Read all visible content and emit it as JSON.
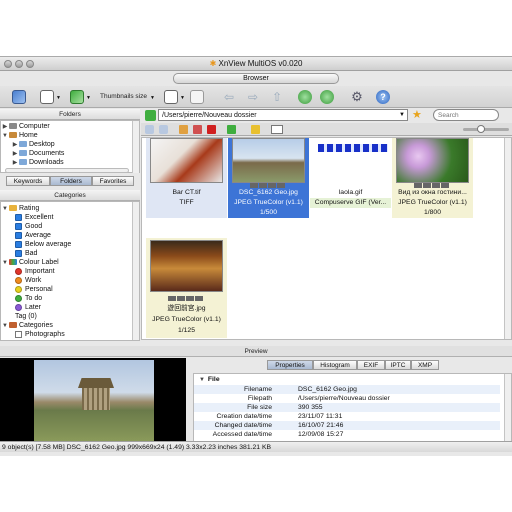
{
  "window": {
    "title": "XnView MultiOS v0.020",
    "browser_tab": "Browser"
  },
  "toolbar": {
    "thumbnails_size_label": "Thumbnails size"
  },
  "address": {
    "path": "/Users/pierre/Nouveau dossier",
    "search_placeholder": "Search"
  },
  "folders_panel": {
    "title": "Folders",
    "items": [
      {
        "label": "Computer",
        "expanded": false,
        "indent": 0
      },
      {
        "label": "Home",
        "expanded": true,
        "indent": 0
      },
      {
        "label": "Desktop",
        "expanded": false,
        "indent": 1
      },
      {
        "label": "Documents",
        "expanded": false,
        "indent": 1
      },
      {
        "label": "Downloads",
        "expanded": false,
        "indent": 1
      }
    ],
    "tabs": [
      "Keywords",
      "Folders",
      "Favorites"
    ],
    "active_tab": "Folders"
  },
  "categories_panel": {
    "title": "Categories",
    "rating": {
      "label": "Rating",
      "items": [
        {
          "label": "Excellent",
          "color": "#2a7de1"
        },
        {
          "label": "Good",
          "color": "#2a7de1"
        },
        {
          "label": "Average",
          "color": "#2a7de1"
        },
        {
          "label": "Below average",
          "color": "#2a7de1"
        },
        {
          "label": "Bad",
          "color": "#2a7de1"
        }
      ]
    },
    "colour_label": {
      "label": "Colour Label",
      "items": [
        {
          "label": "Important",
          "color": "#e0352b"
        },
        {
          "label": "Work",
          "color": "#f08a1c"
        },
        {
          "label": "Personal",
          "color": "#e8d21e"
        },
        {
          "label": "To do",
          "color": "#3fae3f"
        },
        {
          "label": "Later",
          "color": "#8a5ad6"
        }
      ]
    },
    "tag": "Tag (0)",
    "categories": {
      "label": "Categories",
      "items": [
        "Photographs"
      ]
    }
  },
  "thumbnails": [
    {
      "name": "Bar CT.tif",
      "type": "TIFF",
      "counter": "",
      "selected": "blue-light"
    },
    {
      "name": "DSC_6162 Geo.jpg",
      "type": "JPEG TrueColor (v1.1)",
      "counter": "1/500",
      "selected": "blue"
    },
    {
      "name": "laola.gif",
      "type": "Compuserve GIF (Ver...",
      "counter": "",
      "selected": "none"
    },
    {
      "name": "Вид из окна гостини...",
      "type": "JPEG TrueColor (v1.1)",
      "counter": "1/800",
      "selected": "yellow"
    },
    {
      "name": "遊回前宮.jpg",
      "type": "JPEG TrueColor (v1.1)",
      "counter": "1/125",
      "selected": "yellow"
    }
  ],
  "preview": {
    "title": "Preview",
    "tabs": [
      "Properties",
      "Histogram",
      "EXIF",
      "IPTC",
      "XMP"
    ],
    "active_tab": "Properties",
    "section": "File",
    "properties": [
      {
        "key": "Filename",
        "value": "DSC_6162 Geo.jpg"
      },
      {
        "key": "Filepath",
        "value": "/Users/pierre/Nouveau dossier"
      },
      {
        "key": "File size",
        "value": "390 355"
      },
      {
        "key": "Creation date/time",
        "value": "23/11/07 11:31"
      },
      {
        "key": "Changed date/time",
        "value": "16/10/07 21:46"
      },
      {
        "key": "Accessed date/time",
        "value": "12/09/08 15:27"
      }
    ]
  },
  "status": {
    "text": "9 object(s) [7.58 MB]  DSC_6162 Geo.jpg  999x669x24 (1.49)  3.33x2.23 inches  381.21 KB"
  }
}
